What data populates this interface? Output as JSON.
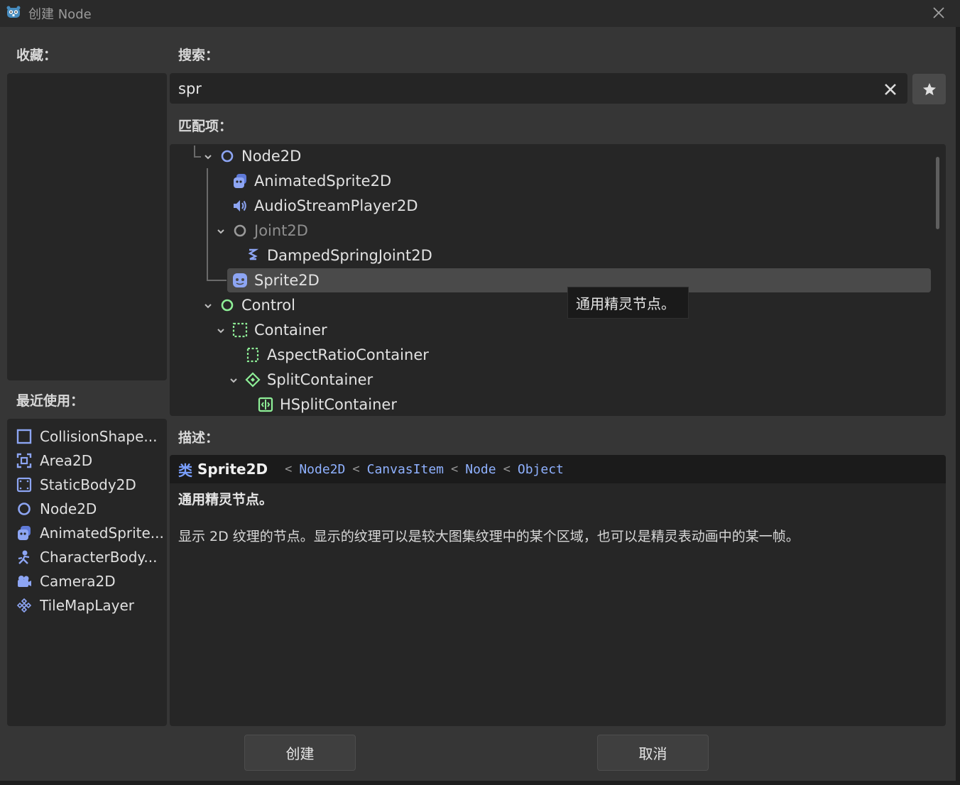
{
  "window": {
    "title": "创建 Node"
  },
  "favorites": {
    "label": "收藏："
  },
  "recent": {
    "label": "最近使用：",
    "items": [
      {
        "label": "CollisionShape...",
        "icon": "collision-shape-icon"
      },
      {
        "label": "Area2D",
        "icon": "area2d-icon"
      },
      {
        "label": "StaticBody2D",
        "icon": "static-body-icon"
      },
      {
        "label": "Node2D",
        "icon": "node2d-icon"
      },
      {
        "label": "AnimatedSprite...",
        "icon": "animated-sprite-icon"
      },
      {
        "label": "CharacterBody...",
        "icon": "character-body-icon"
      },
      {
        "label": "Camera2D",
        "icon": "camera-icon"
      },
      {
        "label": "TileMapLayer",
        "icon": "tilemap-icon"
      }
    ]
  },
  "search": {
    "label": "搜索：",
    "value": "spr"
  },
  "matches": {
    "label": "匹配项：",
    "items": [
      {
        "label": "Node2D"
      },
      {
        "label": "AnimatedSprite2D"
      },
      {
        "label": "AudioStreamPlayer2D"
      },
      {
        "label": "Joint2D"
      },
      {
        "label": "DampedSpringJoint2D"
      },
      {
        "label": "Sprite2D"
      },
      {
        "label": "Control"
      },
      {
        "label": "Container"
      },
      {
        "label": "AspectRatioContainer"
      },
      {
        "label": "SplitContainer"
      },
      {
        "label": "HSplitContainer"
      }
    ]
  },
  "tooltip": {
    "text": "通用精灵节点。"
  },
  "description": {
    "label": "描述：",
    "keyword": "类",
    "class_name": "Sprite2D",
    "separator": "<",
    "inherits": [
      "Node2D",
      "CanvasItem",
      "Node",
      "Object"
    ],
    "brief": "通用精灵节点。",
    "long": "显示 2D 纹理的节点。显示的纹理可以是较大图集纹理中的某个区域，也可以是精灵表动画中的某一帧。"
  },
  "buttons": {
    "create": "创建",
    "cancel": "取消"
  },
  "colors": {
    "node2d_blue": "#8da5f3",
    "control_green": "#8eef97",
    "accent": "#7aa0ff"
  }
}
